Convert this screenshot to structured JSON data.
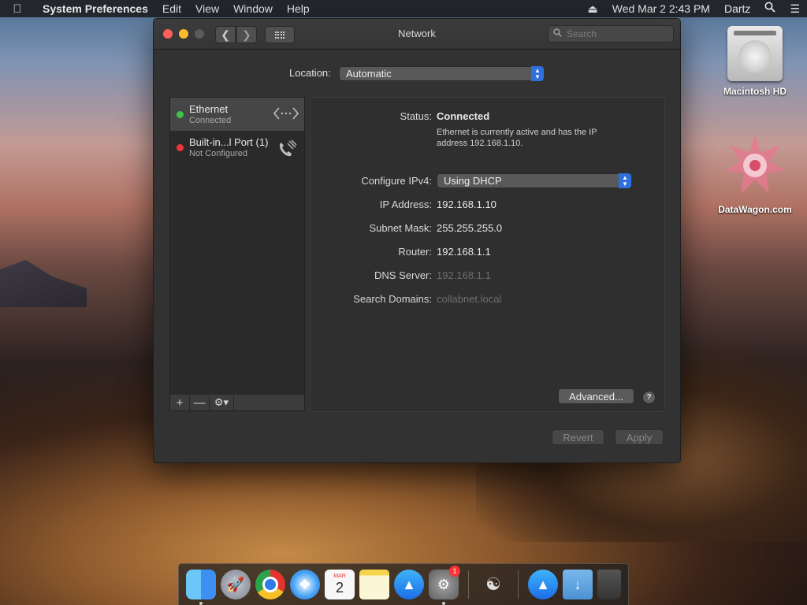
{
  "menubar": {
    "apple_icon": "apple-icon",
    "app_name": "System Preferences",
    "menus": [
      "Edit",
      "View",
      "Window",
      "Help"
    ],
    "eject_icon": "eject-icon",
    "clock": "Wed Mar 2  2:43 PM",
    "user": "Dartz",
    "spotlight_icon": "search-icon",
    "notification_icon": "list-icon"
  },
  "window": {
    "title": "Network",
    "search_placeholder": "Search",
    "location_label": "Location:",
    "location_value": "Automatic",
    "services": [
      {
        "name": "Ethernet",
        "state": "Connected",
        "status_color": "#3bc447",
        "icon": "ethernet-arrows-icon"
      },
      {
        "name": "Built-in...l Port (1)",
        "state": "Not Configured",
        "status_color": "#f0353d",
        "icon": "phone-icon"
      }
    ],
    "detail": {
      "status_label": "Status:",
      "status_value": "Connected",
      "status_desc": "Ethernet is currently active and has the IP address 192.168.1.10.",
      "configure_label": "Configure IPv4:",
      "configure_value": "Using DHCP",
      "ip_label": "IP Address:",
      "ip_value": "192.168.1.10",
      "subnet_label": "Subnet Mask:",
      "subnet_value": "255.255.255.0",
      "router_label": "Router:",
      "router_value": "192.168.1.1",
      "dns_label": "DNS Server:",
      "dns_value": "192.168.1.1",
      "domains_label": "Search Domains:",
      "domains_value": "collabnet.local",
      "advanced_label": "Advanced...",
      "help_label": "?"
    },
    "revert_label": "Revert",
    "apply_label": "Apply"
  },
  "desktop": {
    "icons": [
      {
        "label": "Macintosh HD",
        "icon": "hard-drive-icon"
      },
      {
        "label": "DataWagon.com",
        "icon": "star-emblem-icon"
      }
    ]
  },
  "dock": {
    "calendar_month": "MAR",
    "calendar_day": "2",
    "sysprefs_badge": "1"
  }
}
